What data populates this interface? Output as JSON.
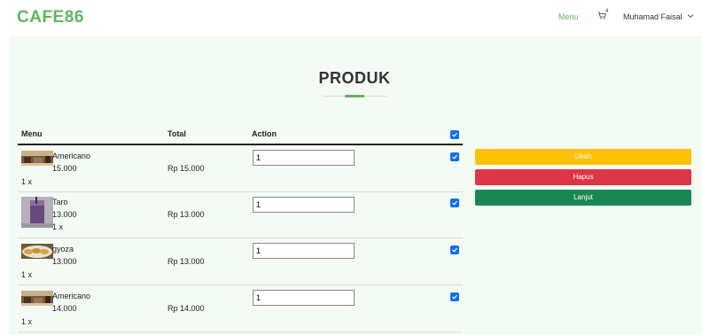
{
  "navbar": {
    "brand": "CAFE86",
    "menu_link": "Menu",
    "cart_count": "4",
    "user_name": "Muhamad Faisal"
  },
  "page": {
    "title": "PRODUK"
  },
  "table": {
    "headers": {
      "menu": "Menu",
      "total": "Total",
      "action": "Action"
    },
    "rows": [
      {
        "name": "Americano",
        "price": "15.000",
        "qty_text": "1 x",
        "total": "Rp 15.000",
        "qty_value": "1",
        "checked": true,
        "thumb": "coffee-shop"
      },
      {
        "name": "Taro",
        "price": "13.000",
        "qty_text": "1 x",
        "total": "Rp 13.000",
        "qty_value": "1",
        "checked": true,
        "thumb": "taro-drink"
      },
      {
        "name": "gyoza",
        "price": "13.000",
        "qty_text": "1 x",
        "total": "Rp 13.000",
        "qty_value": "1",
        "checked": true,
        "thumb": "gyoza-plate"
      },
      {
        "name": "Americano",
        "price": "14.000",
        "qty_text": "1 x",
        "total": "Rp 14.000",
        "qty_value": "1",
        "checked": true,
        "thumb": "coffee-shop"
      }
    ]
  },
  "actions": {
    "ubah": "Ubah",
    "hapus": "Hapus",
    "lanjut": "Lanjut"
  },
  "colors": {
    "brand": "#5cb85c",
    "ubah": "#ffc107",
    "hapus": "#dc3545",
    "lanjut": "#198754",
    "checkbox": "#0d6efd"
  }
}
